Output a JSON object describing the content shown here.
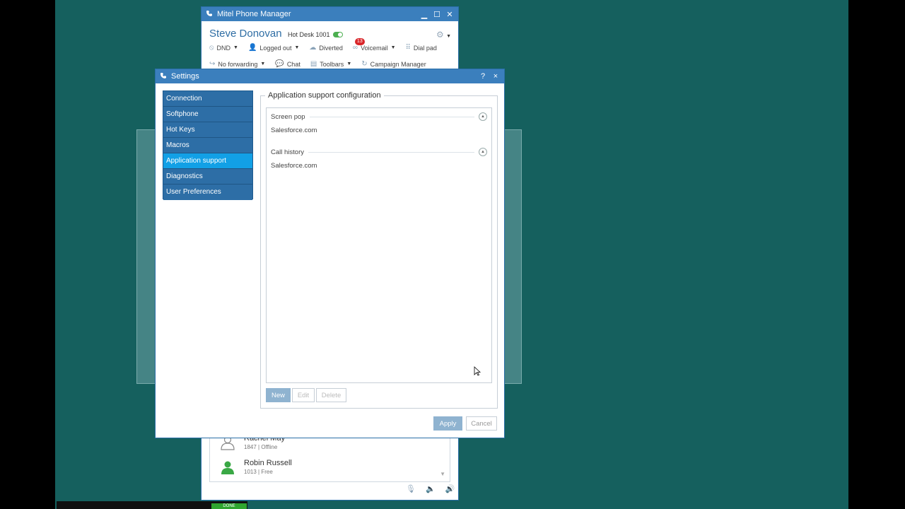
{
  "main_window": {
    "title": "Mitel Phone Manager",
    "user_name": "Steve Donovan",
    "hot_desk": "Hot Desk 1001",
    "toolbar_row1": [
      {
        "label": "DND"
      },
      {
        "label": "Logged out"
      },
      {
        "label": "Diverted"
      },
      {
        "label": "Voicemail",
        "badge": "13"
      },
      {
        "label": "Dial pad"
      }
    ],
    "toolbar_row2": [
      {
        "label": "No forwarding"
      },
      {
        "label": "Chat"
      },
      {
        "label": "Toolbars"
      },
      {
        "label": "Campaign Manager"
      }
    ],
    "contacts": [
      {
        "name": "Rachel May",
        "ext": "1847",
        "status": "Offline"
      },
      {
        "name": "Robin Russell",
        "ext": "1013",
        "status": "Free"
      }
    ],
    "sep": "|"
  },
  "settings": {
    "title": "Settings",
    "help": "?",
    "close": "×",
    "nav": [
      {
        "label": "Connection"
      },
      {
        "label": "Softphone"
      },
      {
        "label": "Hot Keys"
      },
      {
        "label": "Macros"
      },
      {
        "label": "Application support",
        "active": true
      },
      {
        "label": "Diagnostics"
      },
      {
        "label": "User Preferences"
      }
    ],
    "group_title": "Application support configuration",
    "sections": [
      {
        "header": "Screen pop",
        "items": [
          "Salesforce.com"
        ]
      },
      {
        "header": "Call history",
        "items": [
          "Salesforce.com"
        ]
      }
    ],
    "buttons": {
      "new": "New",
      "edit": "Edit",
      "delete": "Delete",
      "apply": "Apply",
      "cancel": "Cancel"
    }
  },
  "taskbar": {
    "done_label": "DONE"
  },
  "colors": {
    "desktop": "#15605e",
    "titlebar": "#3b7fbd",
    "nav": "#2d6ea6",
    "nav_active": "#12a0e6",
    "accent_text": "#2e6da4"
  }
}
